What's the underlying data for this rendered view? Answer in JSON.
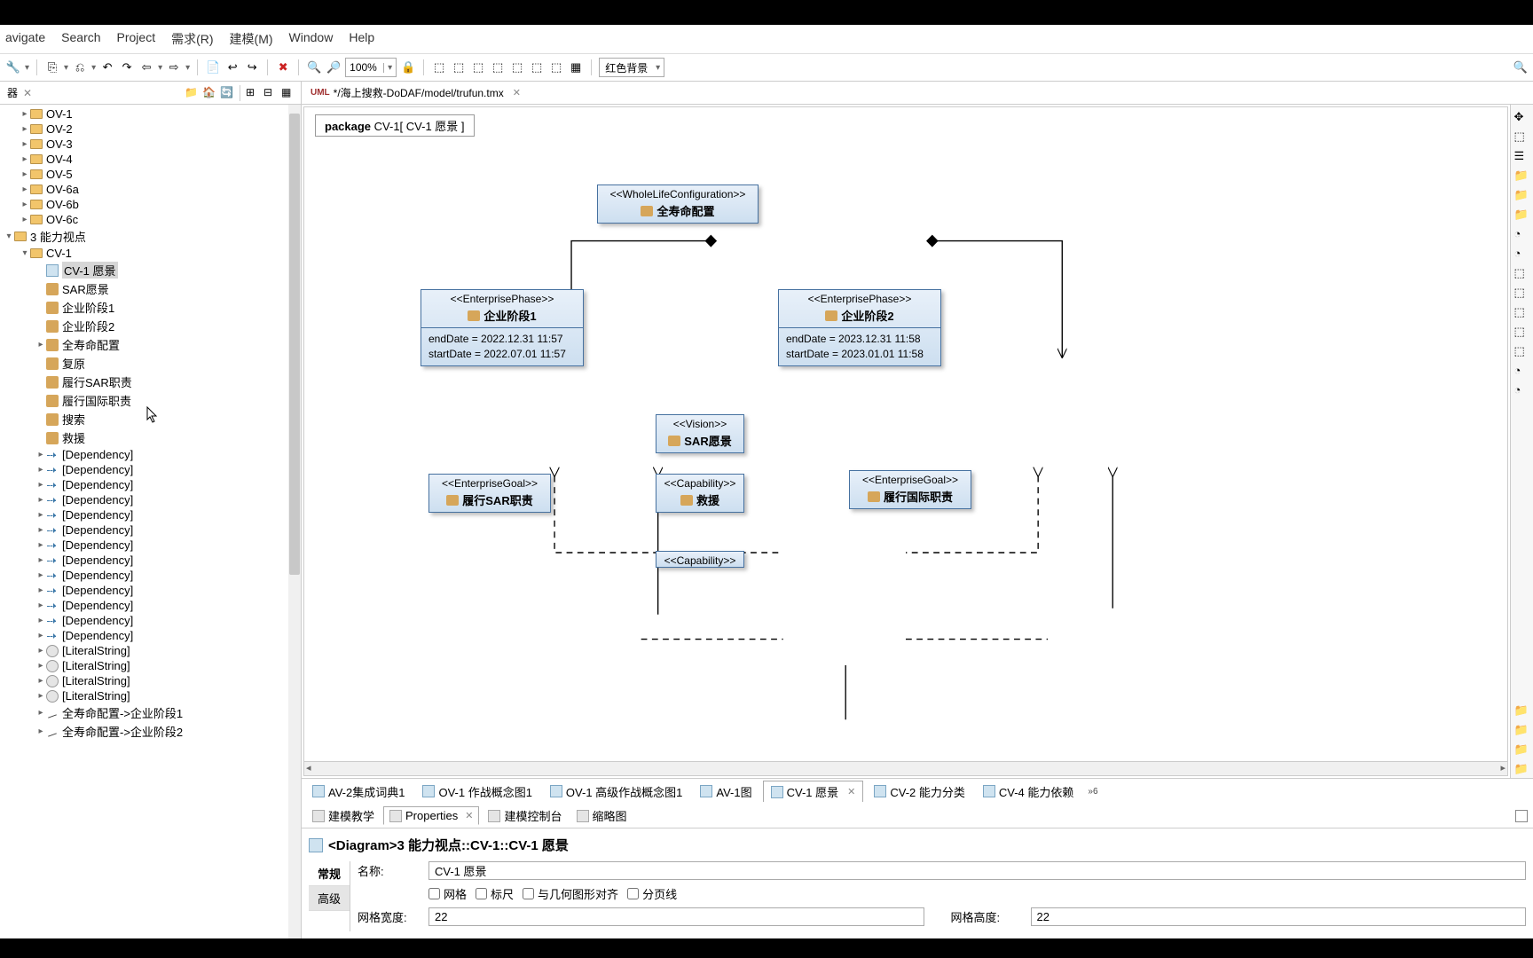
{
  "menu": {
    "items": [
      "avigate",
      "Search",
      "Project",
      "需求(R)",
      "建模(M)",
      "Window",
      "Help"
    ]
  },
  "zoom": "100%",
  "bgSelect": "红色背景",
  "editorTab": {
    "path": "*/海上搜救-DoDAF/model/trufun.tmx"
  },
  "packageLabel": {
    "prefix": "package ",
    "text": "CV-1[ CV-1 愿景 ]"
  },
  "sidebarTab": "器",
  "tree": {
    "ov": [
      "OV-1",
      "OV-2",
      "OV-3",
      "OV-4",
      "OV-5",
      "OV-6a",
      "OV-6b",
      "OV-6c"
    ],
    "cap": "3 能力视点",
    "cv1": "CV-1",
    "cv1children": [
      {
        "t": "diag",
        "l": "CV-1 愿景",
        "sel": true
      },
      {
        "t": "node",
        "l": "SAR愿景"
      },
      {
        "t": "node",
        "l": "企业阶段1"
      },
      {
        "t": "node",
        "l": "企业阶段2"
      },
      {
        "t": "node",
        "l": "全寿命配置",
        "exp": true
      },
      {
        "t": "node",
        "l": "复原"
      },
      {
        "t": "node",
        "l": "履行SAR职责"
      },
      {
        "t": "node",
        "l": "履行国际职责"
      },
      {
        "t": "node",
        "l": "搜索"
      },
      {
        "t": "node",
        "l": "救援"
      }
    ],
    "deps": 13,
    "depLabel": "[Dependency]",
    "lits": 4,
    "litLabel": "[LiteralString]",
    "links": [
      "全寿命配置->企业阶段1",
      "全寿命配置->企业阶段2"
    ]
  },
  "boxes": {
    "root": {
      "stereo": "<<WholeLifeConfiguration>>",
      "name": "全寿命配置"
    },
    "p1": {
      "stereo": "<<EnterprisePhase>>",
      "name": "企业阶段1",
      "a1": "endDate = 2022.12.31 11:57",
      "a2": "startDate = 2022.07.01 11:57"
    },
    "p2": {
      "stereo": "<<EnterprisePhase>>",
      "name": "企业阶段2",
      "a1": "endDate = 2023.12.31 11:58",
      "a2": "startDate = 2023.01.01 11:58"
    },
    "vision": {
      "stereo": "<<Vision>>",
      "name": "SAR愿景"
    },
    "g1": {
      "stereo": "<<EnterpriseGoal>>",
      "name": "履行SAR职责"
    },
    "g2": {
      "stereo": "<<EnterpriseGoal>>",
      "name": "履行国际职责"
    },
    "c1": {
      "stereo": "<<Capability>>",
      "name": "救援"
    },
    "c2": {
      "stereo": "<<Capability>>"
    }
  },
  "bottomTabs": [
    {
      "l": "AV-2集成词典1"
    },
    {
      "l": "OV-1 作战概念图1"
    },
    {
      "l": "OV-1 高级作战概念图1"
    },
    {
      "l": "AV-1图"
    },
    {
      "l": "CV-1 愿景",
      "active": true,
      "close": true
    },
    {
      "l": "CV-2 能力分类"
    },
    {
      "l": "CV-4 能力依赖"
    }
  ],
  "bottomMore": "»6",
  "propTabs": [
    {
      "l": "建模教学"
    },
    {
      "l": "Properties",
      "active": true,
      "close": true
    },
    {
      "l": "建模控制台"
    },
    {
      "l": "缩略图"
    }
  ],
  "propHead": "<Diagram>3 能力视点::CV-1::CV-1 愿景",
  "sideTabs": [
    {
      "l": "常规",
      "active": true
    },
    {
      "l": "高级"
    }
  ],
  "fields": {
    "nameLabel": "名称:",
    "nameVal": "CV-1 愿景",
    "cb": [
      "网格",
      "标尺",
      "与几何图形对齐",
      "分页线"
    ],
    "gwLabel": "网格宽度:",
    "gwVal": "22",
    "ghLabel": "网格高度:",
    "ghVal": "22"
  }
}
